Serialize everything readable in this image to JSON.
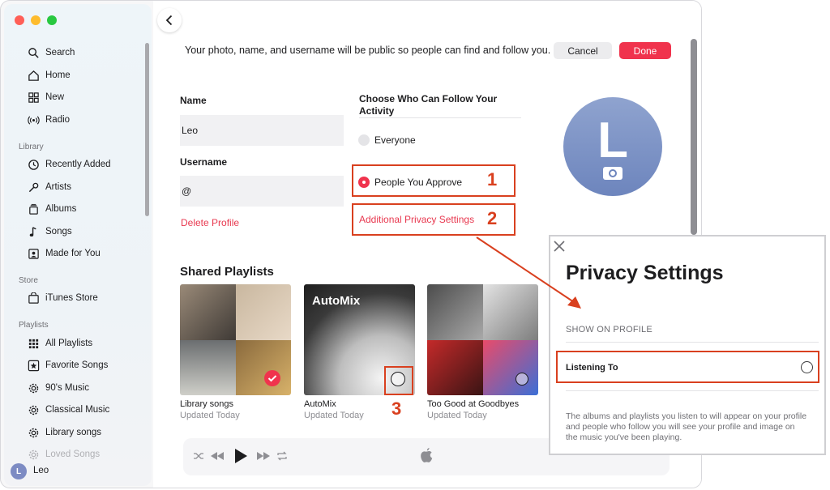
{
  "sidebar": {
    "search": "Search",
    "home": "Home",
    "new": "New",
    "radio": "Radio",
    "library_header": "Library",
    "recently_added": "Recently Added",
    "artists": "Artists",
    "albums": "Albums",
    "songs": "Songs",
    "made_for_you": "Made for You",
    "store_header": "Store",
    "itunes_store": "iTunes Store",
    "playlists_header": "Playlists",
    "all_playlists": "All Playlists",
    "favorite_songs": "Favorite Songs",
    "nineties_music": "90's Music",
    "classical_music": "Classical Music",
    "library_songs": "Library songs",
    "loved_songs": "Loved Songs",
    "user_initial": "L",
    "user_name": "Leo"
  },
  "header": {
    "message": "Your photo, name, and username will be public so people can find and follow you.",
    "cancel": "Cancel",
    "done": "Done"
  },
  "profile": {
    "name_label": "Name",
    "name_value": "Leo",
    "username_label": "Username",
    "username_value": "@",
    "delete_label": "Delete Profile",
    "avatar_letter": "L"
  },
  "follow": {
    "title": "Choose Who Can Follow Your Activity",
    "everyone": "Everyone",
    "people_you_approve": "People You Approve",
    "additional_privacy": "Additional Privacy Settings"
  },
  "shared": {
    "title": "Shared Playlists",
    "playlists": [
      {
        "name": "Library songs",
        "sub": "Updated Today"
      },
      {
        "name": "AutoMix",
        "sub": "Updated Today",
        "art_text": "AutoMix"
      },
      {
        "name": "Too Good at Goodbyes",
        "sub": "Updated Today"
      }
    ]
  },
  "annotations": {
    "one": "1",
    "two": "2",
    "three": "3"
  },
  "privacy_panel": {
    "title": "Privacy Settings",
    "section": "SHOW ON PROFILE",
    "row_label": "Listening To",
    "description": "The albums and playlists you listen to will appear on your profile and people who follow you will see your profile and image on the music you've been playing."
  },
  "colors": {
    "accent": "#f0334d",
    "annotation": "#d9401f",
    "avatar": "#7d8bc3"
  }
}
